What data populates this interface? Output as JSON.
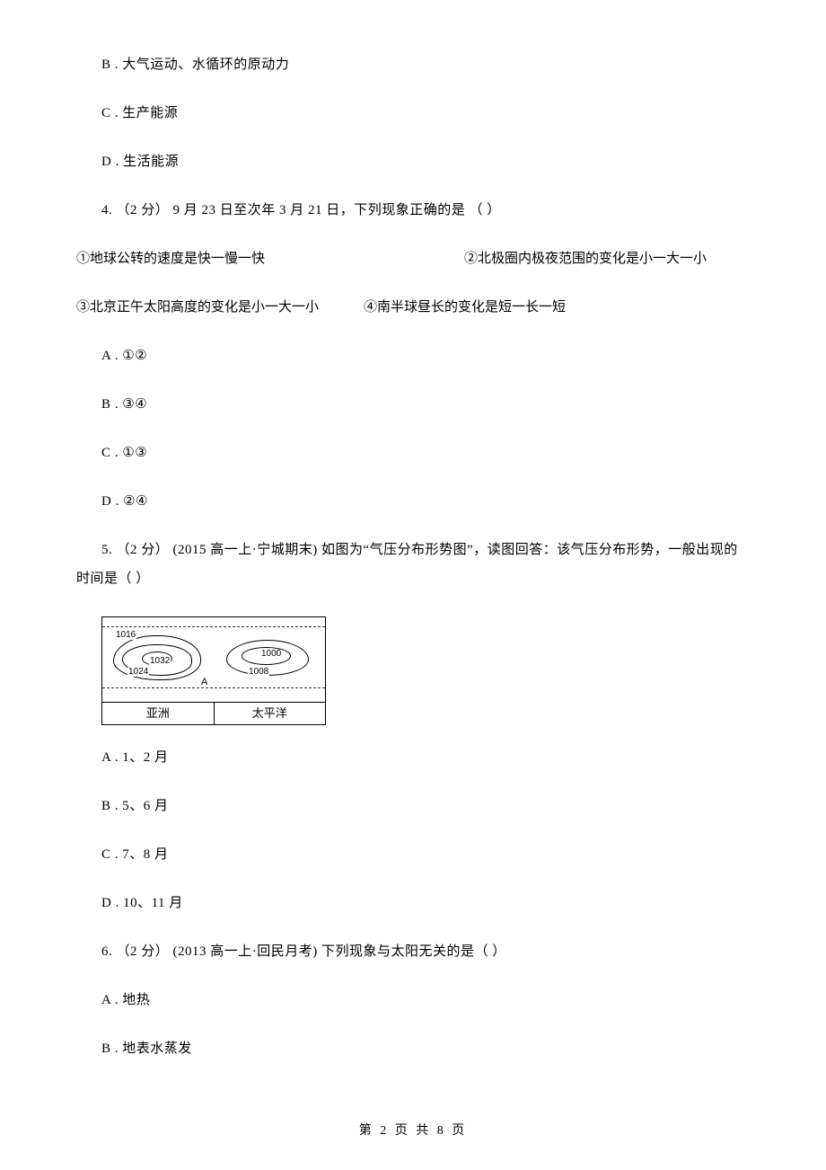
{
  "q3": {
    "opt_b": "B . 大气运动、水循环的原动力",
    "opt_c": "C . 生产能源",
    "opt_d": "D . 生活能源"
  },
  "q4": {
    "stem": "4. （2 分） 9 月 23 日至次年 3 月 21 日，下列现象正确的是  （    ）",
    "stmt1": "①地球公转的速度是快一慢一快",
    "stmt2": "②北极圈内极夜范围的变化是小一大一小",
    "stmt3": "③北京正午太阳高度的变化是小一大一小",
    "stmt4": "④南半球昼长的变化是短一长一短",
    "opt_a": "A . ①②",
    "opt_b": "B . ③④",
    "opt_c": "C . ①③",
    "opt_d": "D . ②④"
  },
  "q5": {
    "stem_l1": "5. （2 分） (2015 高一上·宁城期末) 如图为“气压分布形势图”，读图回答：该气压分布形势，一般出现的",
    "stem_l2": "时间是（    ）",
    "fig": {
      "p1016": "1016",
      "p1024": "1024",
      "p1032": "1032",
      "p1000": "1000",
      "p1008": "1008",
      "A": "A",
      "labelL": "亚洲",
      "labelR": "太平洋"
    },
    "opt_a": "A . 1、2 月",
    "opt_b": "B . 5、6 月",
    "opt_c": "C . 7、8 月",
    "opt_d": "D . 10、11 月"
  },
  "q6": {
    "stem": "6. （2 分） (2013 高一上·回民月考) 下列现象与太阳无关的是（    ）",
    "opt_a": "A . 地热",
    "opt_b": "B . 地表水蒸发"
  },
  "footer": "第 2 页 共 8 页"
}
